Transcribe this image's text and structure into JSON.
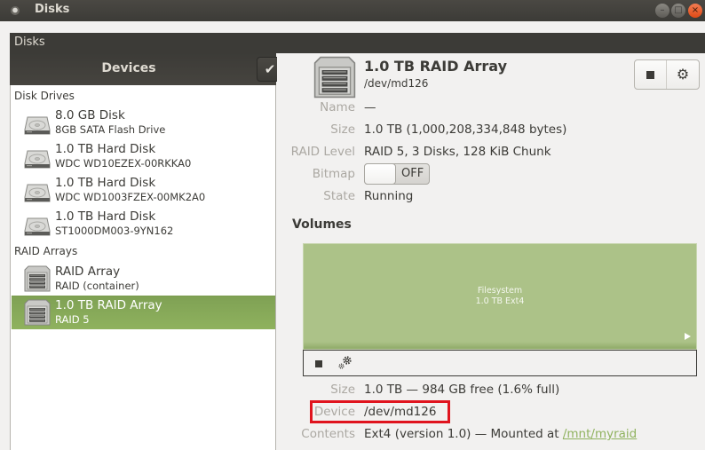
{
  "window": {
    "title": "Disks",
    "controls": {
      "minimize": "–",
      "maximize": "□",
      "close": "×"
    }
  },
  "headerbar": {
    "title": "Disks"
  },
  "sidebar": {
    "header": "Devices",
    "select_icon": "✔",
    "sections": [
      {
        "label": "Disk Drives",
        "items": [
          {
            "name": "8.0 GB Disk",
            "sub": "8GB SATA Flash Drive",
            "icon": "hard-disk-icon",
            "selected": false
          },
          {
            "name": "1.0 TB Hard Disk",
            "sub": "WDC WD10EZEX-00RKKA0",
            "icon": "hard-disk-icon",
            "selected": false
          },
          {
            "name": "1.0 TB Hard Disk",
            "sub": "WDC WD1003FZEX-00MK2A0",
            "icon": "hard-disk-icon",
            "selected": false
          },
          {
            "name": "1.0 TB Hard Disk",
            "sub": "ST1000DM003-9YN162",
            "icon": "hard-disk-icon",
            "selected": false
          }
        ]
      },
      {
        "label": "RAID Arrays",
        "items": [
          {
            "name": "RAID Array",
            "sub": "RAID (container)",
            "icon": "raid-array-icon",
            "selected": false
          },
          {
            "name": "1.0 TB RAID Array",
            "sub": "RAID 5",
            "icon": "raid-array-icon",
            "selected": true
          }
        ]
      }
    ]
  },
  "main": {
    "title": "1.0 TB RAID Array",
    "path": "/dev/md126",
    "properties": [
      {
        "label": "Name",
        "value": "—"
      },
      {
        "label": "Size",
        "value": "1.0 TB (1,000,208,334,848 bytes)"
      },
      {
        "label": "RAID Level",
        "value": "RAID 5, 3 Disks, 128 KiB Chunk"
      },
      {
        "label": "Bitmap",
        "value": "OFF"
      },
      {
        "label": "State",
        "value": "Running"
      }
    ],
    "bitmap_enabled": false,
    "volumes": {
      "title": "Volumes",
      "partition": {
        "line1": "Filesystem",
        "line2": "1.0 TB Ext4",
        "color": "#acc288"
      },
      "details": [
        {
          "label": "Size",
          "value": "1.0 TB — 984 GB free (1.6% full)"
        },
        {
          "label": "Device",
          "value": "/dev/md126"
        },
        {
          "label": "Contents",
          "value": "Ext4 (version 1.0) — Mounted at ",
          "link": "/mnt/myraid"
        }
      ]
    }
  },
  "colors": {
    "accent": "#8fb25e",
    "highlight_box": "#e0141e",
    "titlebar": "#3c3b37"
  }
}
